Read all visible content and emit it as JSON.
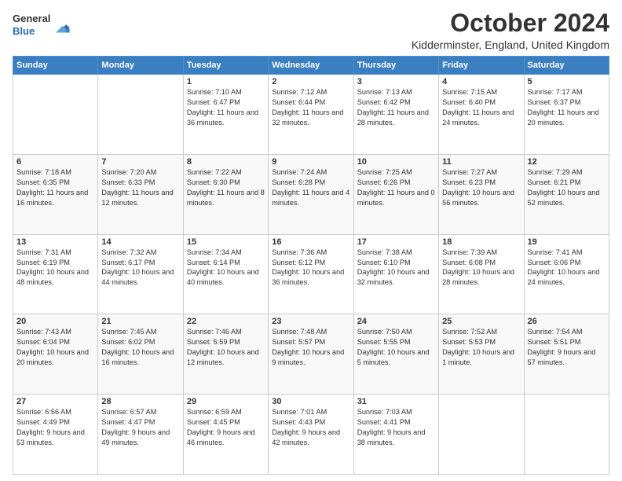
{
  "logo": {
    "general": "General",
    "blue": "Blue"
  },
  "header": {
    "month": "October 2024",
    "location": "Kidderminster, England, United Kingdom"
  },
  "weekdays": [
    "Sunday",
    "Monday",
    "Tuesday",
    "Wednesday",
    "Thursday",
    "Friday",
    "Saturday"
  ],
  "weeks": [
    [
      {
        "day": "",
        "info": ""
      },
      {
        "day": "",
        "info": ""
      },
      {
        "day": "1",
        "info": "Sunrise: 7:10 AM\nSunset: 6:47 PM\nDaylight: 11 hours and 36 minutes."
      },
      {
        "day": "2",
        "info": "Sunrise: 7:12 AM\nSunset: 6:44 PM\nDaylight: 11 hours and 32 minutes."
      },
      {
        "day": "3",
        "info": "Sunrise: 7:13 AM\nSunset: 6:42 PM\nDaylight: 11 hours and 28 minutes."
      },
      {
        "day": "4",
        "info": "Sunrise: 7:15 AM\nSunset: 6:40 PM\nDaylight: 11 hours and 24 minutes."
      },
      {
        "day": "5",
        "info": "Sunrise: 7:17 AM\nSunset: 6:37 PM\nDaylight: 11 hours and 20 minutes."
      }
    ],
    [
      {
        "day": "6",
        "info": "Sunrise: 7:18 AM\nSunset: 6:35 PM\nDaylight: 11 hours and 16 minutes."
      },
      {
        "day": "7",
        "info": "Sunrise: 7:20 AM\nSunset: 6:33 PM\nDaylight: 11 hours and 12 minutes."
      },
      {
        "day": "8",
        "info": "Sunrise: 7:22 AM\nSunset: 6:30 PM\nDaylight: 11 hours and 8 minutes."
      },
      {
        "day": "9",
        "info": "Sunrise: 7:24 AM\nSunset: 6:28 PM\nDaylight: 11 hours and 4 minutes."
      },
      {
        "day": "10",
        "info": "Sunrise: 7:25 AM\nSunset: 6:26 PM\nDaylight: 11 hours and 0 minutes."
      },
      {
        "day": "11",
        "info": "Sunrise: 7:27 AM\nSunset: 6:23 PM\nDaylight: 10 hours and 56 minutes."
      },
      {
        "day": "12",
        "info": "Sunrise: 7:29 AM\nSunset: 6:21 PM\nDaylight: 10 hours and 52 minutes."
      }
    ],
    [
      {
        "day": "13",
        "info": "Sunrise: 7:31 AM\nSunset: 6:19 PM\nDaylight: 10 hours and 48 minutes."
      },
      {
        "day": "14",
        "info": "Sunrise: 7:32 AM\nSunset: 6:17 PM\nDaylight: 10 hours and 44 minutes."
      },
      {
        "day": "15",
        "info": "Sunrise: 7:34 AM\nSunset: 6:14 PM\nDaylight: 10 hours and 40 minutes."
      },
      {
        "day": "16",
        "info": "Sunrise: 7:36 AM\nSunset: 6:12 PM\nDaylight: 10 hours and 36 minutes."
      },
      {
        "day": "17",
        "info": "Sunrise: 7:38 AM\nSunset: 6:10 PM\nDaylight: 10 hours and 32 minutes."
      },
      {
        "day": "18",
        "info": "Sunrise: 7:39 AM\nSunset: 6:08 PM\nDaylight: 10 hours and 28 minutes."
      },
      {
        "day": "19",
        "info": "Sunrise: 7:41 AM\nSunset: 6:06 PM\nDaylight: 10 hours and 24 minutes."
      }
    ],
    [
      {
        "day": "20",
        "info": "Sunrise: 7:43 AM\nSunset: 6:04 PM\nDaylight: 10 hours and 20 minutes."
      },
      {
        "day": "21",
        "info": "Sunrise: 7:45 AM\nSunset: 6:02 PM\nDaylight: 10 hours and 16 minutes."
      },
      {
        "day": "22",
        "info": "Sunrise: 7:46 AM\nSunset: 5:59 PM\nDaylight: 10 hours and 12 minutes."
      },
      {
        "day": "23",
        "info": "Sunrise: 7:48 AM\nSunset: 5:57 PM\nDaylight: 10 hours and 9 minutes."
      },
      {
        "day": "24",
        "info": "Sunrise: 7:50 AM\nSunset: 5:55 PM\nDaylight: 10 hours and 5 minutes."
      },
      {
        "day": "25",
        "info": "Sunrise: 7:52 AM\nSunset: 5:53 PM\nDaylight: 10 hours and 1 minute."
      },
      {
        "day": "26",
        "info": "Sunrise: 7:54 AM\nSunset: 5:51 PM\nDaylight: 9 hours and 57 minutes."
      }
    ],
    [
      {
        "day": "27",
        "info": "Sunrise: 6:56 AM\nSunset: 4:49 PM\nDaylight: 9 hours and 53 minutes."
      },
      {
        "day": "28",
        "info": "Sunrise: 6:57 AM\nSunset: 4:47 PM\nDaylight: 9 hours and 49 minutes."
      },
      {
        "day": "29",
        "info": "Sunrise: 6:59 AM\nSunset: 4:45 PM\nDaylight: 9 hours and 46 minutes."
      },
      {
        "day": "30",
        "info": "Sunrise: 7:01 AM\nSunset: 4:43 PM\nDaylight: 9 hours and 42 minutes."
      },
      {
        "day": "31",
        "info": "Sunrise: 7:03 AM\nSunset: 4:41 PM\nDaylight: 9 hours and 38 minutes."
      },
      {
        "day": "",
        "info": ""
      },
      {
        "day": "",
        "info": ""
      }
    ]
  ]
}
